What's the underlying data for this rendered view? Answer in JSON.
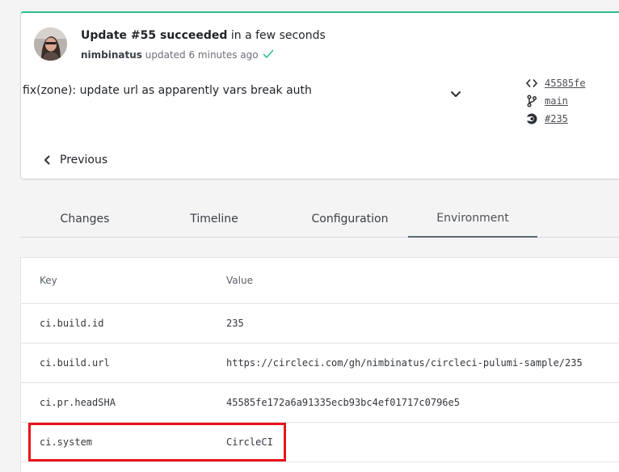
{
  "update": {
    "title_strong": "Update #55 succeeded",
    "title_rest": " in a few seconds",
    "user": "nimbinatus",
    "meta_text": " updated 6 minutes ago",
    "commit_message": "fix(zone): update url as apparently vars break auth",
    "links": {
      "commit": "45585fe",
      "branch": "main",
      "build": "#235"
    },
    "previous_label": "Previous"
  },
  "tabs": [
    {
      "label": "Changes"
    },
    {
      "label": "Timeline"
    },
    {
      "label": "Configuration"
    },
    {
      "label": "Environment"
    }
  ],
  "active_tab": "Environment",
  "environment": {
    "headers": {
      "key": "Key",
      "value": "Value"
    },
    "rows": [
      {
        "key": "ci.build.id",
        "value": "235"
      },
      {
        "key": "ci.build.url",
        "value": "https://circleci.com/gh/nimbinatus/circleci-pulumi-sample/235"
      },
      {
        "key": "ci.pr.headSHA",
        "value": "45585fe172a6a91335ecb93bc4ef01717c0796e5"
      },
      {
        "key": "ci.system",
        "value": "CircleCI"
      }
    ]
  },
  "colors": {
    "success": "#2ebf8a",
    "highlight": "#e8131b"
  }
}
